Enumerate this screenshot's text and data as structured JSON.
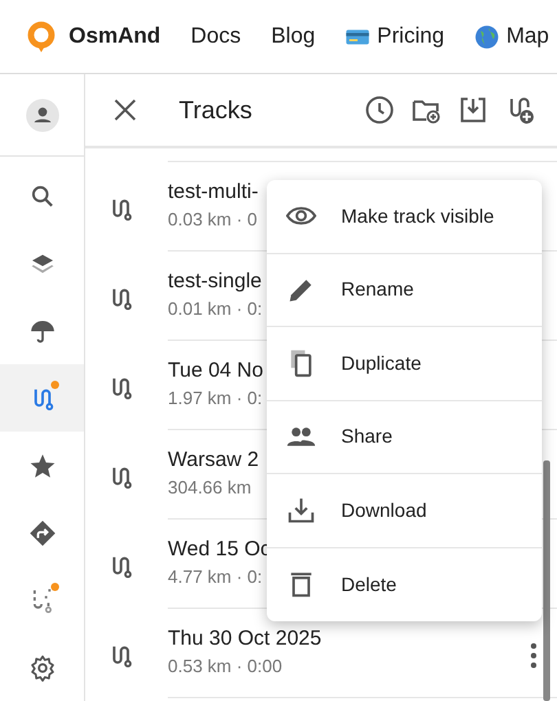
{
  "navbar": {
    "brand": "OsmAnd",
    "links": [
      {
        "label": "Docs"
      },
      {
        "label": "Blog"
      },
      {
        "label": "Pricing"
      },
      {
        "label": "Map"
      }
    ]
  },
  "sidebar": {
    "items": [
      {
        "selected": false,
        "dot": false
      },
      {
        "selected": false,
        "dot": false
      },
      {
        "selected": false,
        "dot": false
      },
      {
        "selected": true,
        "dot": true
      },
      {
        "selected": false,
        "dot": false
      },
      {
        "selected": false,
        "dot": false
      },
      {
        "selected": false,
        "dot": true
      },
      {
        "selected": false,
        "dot": false
      }
    ]
  },
  "panel": {
    "title": "Tracks",
    "tracks": [
      {
        "name": "test-multi-",
        "meta": "0.03 km · 0"
      },
      {
        "name": "test-single",
        "meta": "0.01 km · 0:"
      },
      {
        "name": "Tue 04 No",
        "meta": "1.97 km · 0:"
      },
      {
        "name": "Warsaw 2",
        "meta": "304.66 km"
      },
      {
        "name": "Wed 15 Oc",
        "meta": "4.77 km · 0:"
      },
      {
        "name": "Thu 30 Oct 2025",
        "meta": "0.53 km · 0:00"
      }
    ]
  },
  "context_menu": {
    "items": [
      {
        "label": "Make track visible"
      },
      {
        "label": "Rename"
      },
      {
        "label": "Duplicate"
      },
      {
        "label": "Share"
      },
      {
        "label": "Download"
      },
      {
        "label": "Delete"
      }
    ]
  }
}
